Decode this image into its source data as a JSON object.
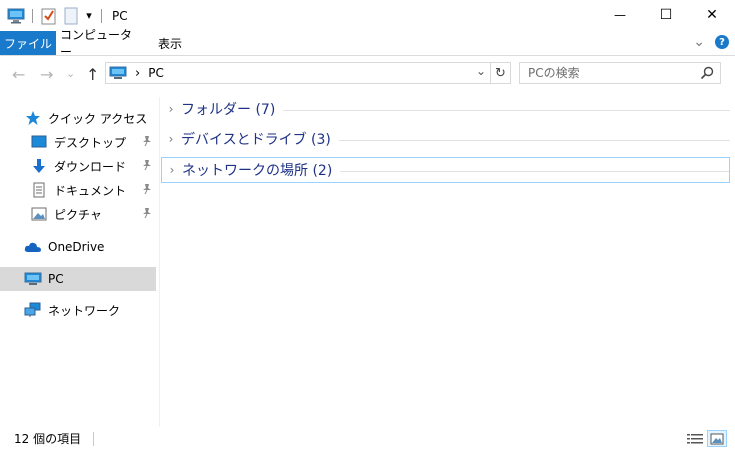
{
  "window": {
    "title": "PC",
    "qa_dropdown": "▾",
    "minimize": "—",
    "maximize": "☐",
    "close": "✕"
  },
  "ribbon": {
    "tabs": [
      {
        "label": "ファイル",
        "active": true
      },
      {
        "label": "コンピューター",
        "active": false
      },
      {
        "label": "表示",
        "active": false
      }
    ],
    "expand_glyph": "⌄",
    "help_glyph": "?"
  },
  "address": {
    "back": "←",
    "forward": "→",
    "recent": "⌄",
    "up": "↑",
    "separator": "›",
    "path": "PC",
    "dropdown": "⌄",
    "refresh": "↻"
  },
  "search": {
    "placeholder": "PCの検索"
  },
  "nav": {
    "quick_access": "クイック アクセス",
    "items": [
      {
        "label": "デスクトップ",
        "icon": "desktop-icon"
      },
      {
        "label": "ダウンロード",
        "icon": "download-icon"
      },
      {
        "label": "ドキュメント",
        "icon": "document-icon"
      },
      {
        "label": "ピクチャ",
        "icon": "pictures-icon"
      }
    ],
    "onedrive": "OneDrive",
    "pc": "PC",
    "network": "ネットワーク"
  },
  "groups": [
    {
      "label": "フォルダー (7)"
    },
    {
      "label": "デバイスとドライブ (3)"
    },
    {
      "label": "ネットワークの場所 (2)"
    }
  ],
  "status": {
    "count": "12 個の項目"
  },
  "colors": {
    "accent": "#1979ca",
    "group_text": "#1e3287",
    "selection": "#d9d9d9"
  }
}
